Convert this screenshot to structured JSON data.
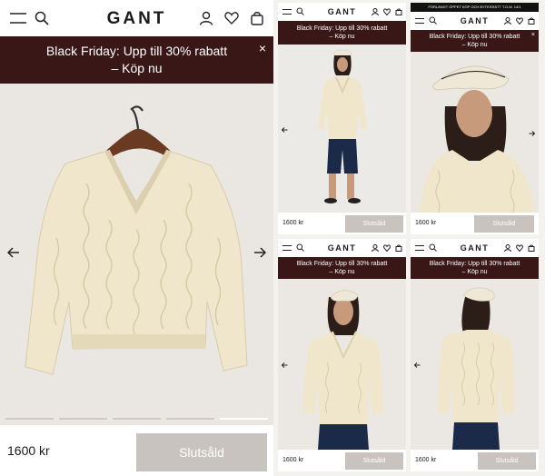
{
  "brand": "GANT",
  "banner": {
    "line1": "Black Friday: Upp till 30% rabatt",
    "line2": "– Köp nu",
    "close": "×"
  },
  "top_strip": "FÖRLÄNGT ÖPPET KÖP OCH BYTESRÄTT T.O.M. 14/1",
  "product": {
    "price": "1600 kr",
    "button": "Slutsåld"
  },
  "icons": [
    "menu-icon",
    "search-icon",
    "account-icon",
    "heart-icon",
    "bag-icon",
    "arrow-left-icon",
    "arrow-right-icon"
  ],
  "colors": {
    "banner": "#3a1717",
    "sold_button": "#c9c3bf",
    "sweater": "#efe6cc",
    "shorts": "#1c2a4a"
  },
  "carousel": {
    "slides": 5,
    "active": 5
  }
}
